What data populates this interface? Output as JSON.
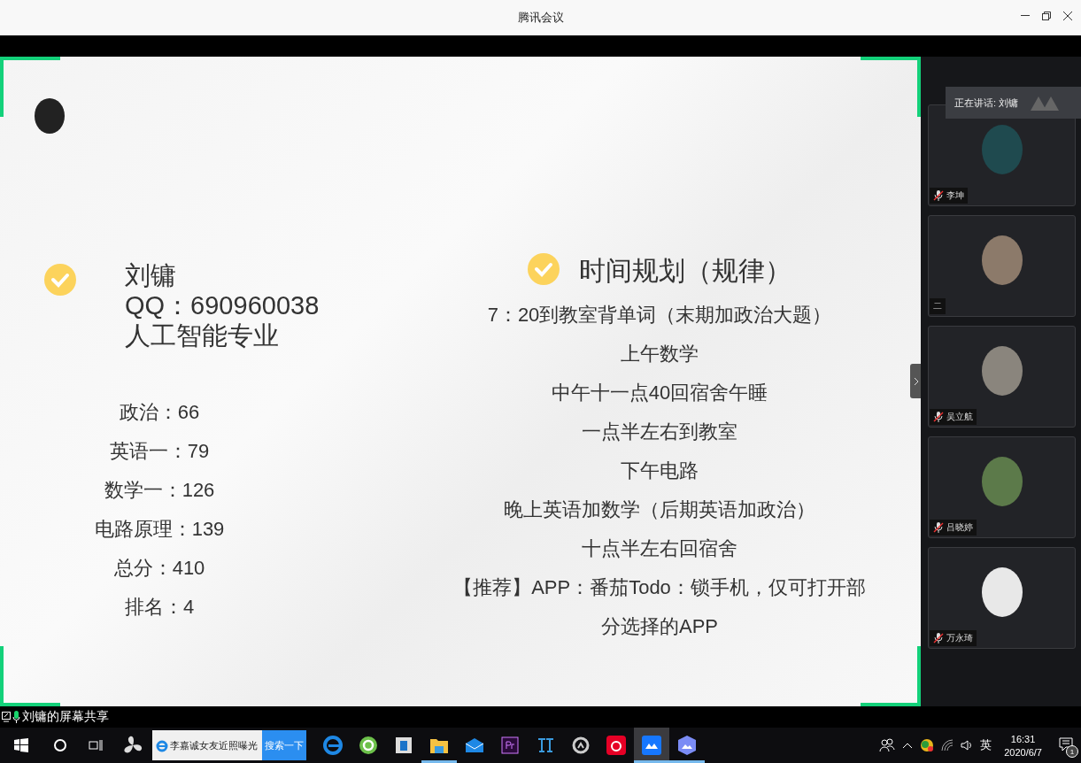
{
  "window": {
    "title": "腾讯会议"
  },
  "slide": {
    "profile": {
      "name": "刘镛",
      "qq": "QQ：690960038",
      "major": "人工智能专业"
    },
    "scores": [
      "政治：66",
      "英语一：79",
      "数学一：126",
      "电路原理：139",
      "总分：410",
      "排名：4"
    ],
    "plan": {
      "heading": "时间规划（规律）",
      "lines": [
        "7：20到教室背单词（末期加政治大题）",
        "上午数学",
        "中午十一点40回宿舍午睡",
        "一点半左右到教室",
        "下午电路",
        "晚上英语加数学（后期英语加政治）",
        "十点半左右回宿舍",
        "【推荐】APP：番茄Todo：锁手机，仅可打开部",
        "分选择的APP"
      ]
    }
  },
  "speaking": "正在讲话: 刘镛",
  "participants": [
    {
      "name": "李坤",
      "muted": true
    },
    {
      "name": "二",
      "muted": false
    },
    {
      "name": "吴立航",
      "muted": true
    },
    {
      "name": "吕晓婷",
      "muted": true
    },
    {
      "name": "万永琦",
      "muted": true
    }
  ],
  "share_bar": {
    "label": "刘镛的屏幕共享"
  },
  "taskbar": {
    "search": {
      "value": "李嘉诚女友近照曝光",
      "button": "搜索一下"
    },
    "apps": [
      {
        "kind": "edge",
        "selected": false,
        "running": false
      },
      {
        "kind": "ie",
        "selected": false,
        "running": false
      },
      {
        "kind": "window",
        "selected": false,
        "running": false
      },
      {
        "kind": "folder",
        "selected": false,
        "running": true
      },
      {
        "kind": "mail",
        "selected": false,
        "running": false
      },
      {
        "kind": "premiere",
        "selected": false,
        "running": false
      },
      {
        "kind": "tool",
        "selected": false,
        "running": false
      },
      {
        "kind": "game",
        "selected": false,
        "running": false
      },
      {
        "kind": "music",
        "selected": false,
        "running": false
      },
      {
        "kind": "meeting",
        "selected": true,
        "running": true
      },
      {
        "kind": "photos",
        "selected": false,
        "running": true
      }
    ],
    "language": "英",
    "time": "16:31",
    "date": "2020/6/7",
    "notifications": "1"
  }
}
